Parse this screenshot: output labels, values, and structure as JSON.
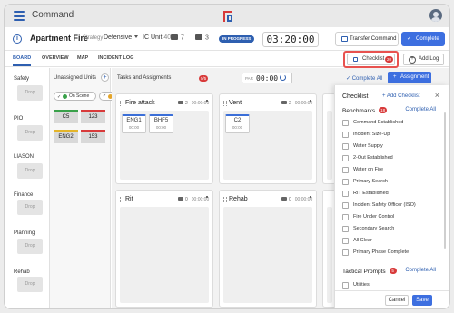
{
  "app": {
    "title": "Command"
  },
  "incident": {
    "name": "Apartment Fire",
    "strategy_label": "Strategy",
    "strategy_value": "Defensive",
    "ic_unit_label": "IC Unit",
    "ic_unit_value": "401",
    "units_count": "7",
    "tasks_count": "3",
    "status": "IN PROGRESS",
    "timer": "03:20:00"
  },
  "header_buttons": {
    "transfer": "Transfer Command",
    "complete": "Complete"
  },
  "tabs": [
    "BOARD",
    "OVERVIEW",
    "MAP",
    "INCIDENT LOG"
  ],
  "toolbar": {
    "checklist_label": "Checklist",
    "checklist_count": "20",
    "add_log": "Add Log"
  },
  "sidebar": [
    {
      "label": "Safety",
      "drop": "Drop"
    },
    {
      "label": "PIO",
      "drop": "Drop"
    },
    {
      "label": "LIASON",
      "drop": "Drop"
    },
    {
      "label": "Finance",
      "drop": "Drop"
    },
    {
      "label": "Planning",
      "drop": "Drop"
    },
    {
      "label": "Rehab",
      "drop": "Drop"
    }
  ],
  "unassigned": {
    "title": "Unassigned Units",
    "filter": "On Scene",
    "units": [
      {
        "name": "C5",
        "color": "#3aa14a"
      },
      {
        "name": "123",
        "color": "#d83a3a"
      },
      {
        "name": "ENG2",
        "color": "#e4b52a"
      },
      {
        "name": "153",
        "color": "#d83a3a"
      }
    ]
  },
  "tasks": {
    "title": "Tasks and Assigments",
    "badge": "0/5",
    "par_label": "PAR",
    "par_value": "00:00",
    "complete_all": "Complete All",
    "assign": "Assignment",
    "cards": [
      {
        "name": "Fire attack",
        "units": "2",
        "time": "00:00:00",
        "chips": [
          {
            "name": "ENG1",
            "time": "00:00"
          },
          {
            "name": "BHF5",
            "time": "00:00"
          }
        ]
      },
      {
        "name": "Vent",
        "units": "2",
        "time": "00:00:00",
        "chips": [
          {
            "name": "C2",
            "time": "00:00"
          }
        ]
      },
      {
        "name": "Rit",
        "units": "0",
        "time": "00:00:00",
        "chips": []
      },
      {
        "name": "Rehab",
        "units": "0",
        "time": "00:00:00",
        "chips": []
      }
    ]
  },
  "checklist": {
    "title": "Checklist",
    "add": "Add Checklist",
    "benchmarks_label": "Benchmarks",
    "benchmarks_count": "18",
    "complete_all": "Complete All",
    "items": [
      "Command Established",
      "Incident Size-Up",
      "Water Supply",
      "2-Out Established",
      "Water on Fire",
      "Primary Search",
      "RIT Established",
      "Incident Safety Officer (ISO)",
      "Fire Under Control",
      "Secondary Search",
      "All Clear",
      "Primary Phase Complete"
    ],
    "tactical_label": "Tactical Prompts",
    "tactical_count": "5",
    "tactical_complete_all": "Complete All",
    "tactical_items": [
      "Utilities"
    ],
    "cancel": "Cancel",
    "save": "Save"
  }
}
